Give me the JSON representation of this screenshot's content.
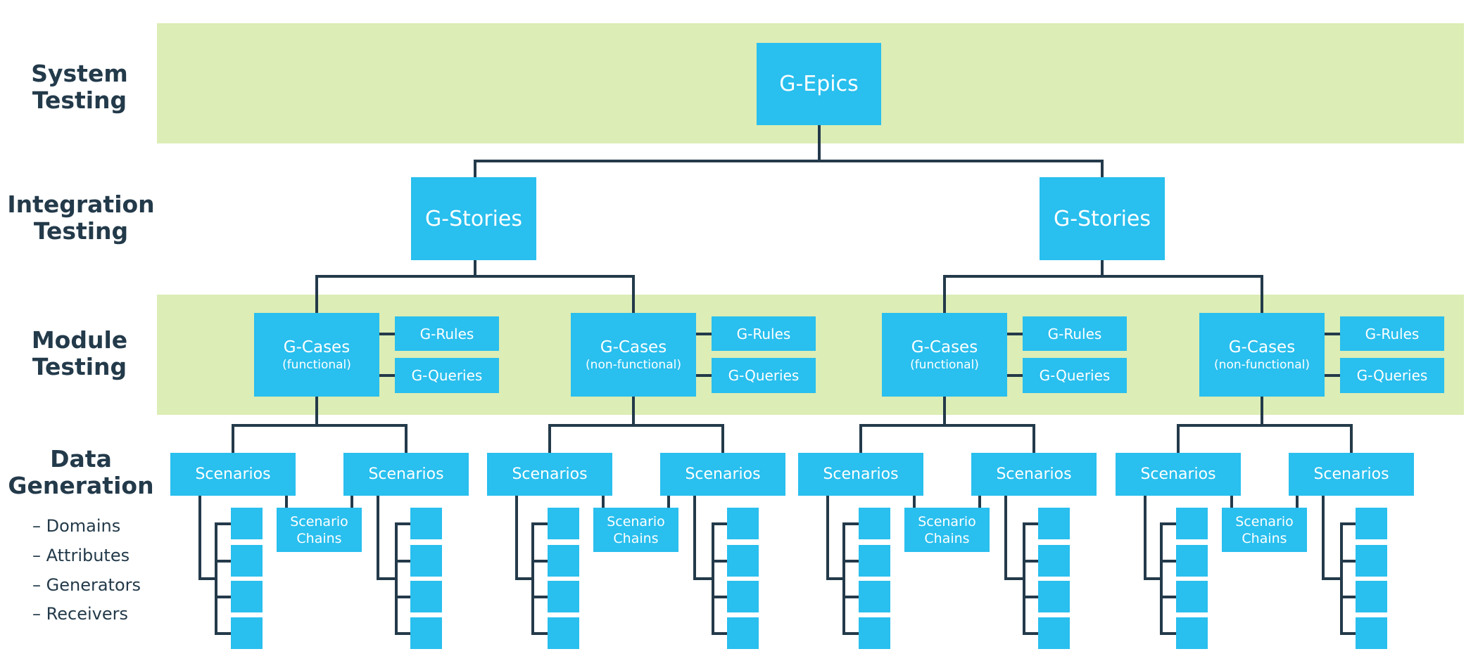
{
  "levels": {
    "system": [
      "System",
      "Testing"
    ],
    "integration": [
      "Integration",
      "Testing"
    ],
    "module": [
      "Module",
      "Testing"
    ],
    "data": [
      "Data",
      "Generation"
    ]
  },
  "data_items": [
    "– Domains",
    "– Attributes",
    "– Generators",
    "– Receivers"
  ],
  "epic": "G-Epics",
  "stories": [
    "G-Stories",
    "G-Stories"
  ],
  "case_groups": [
    {
      "title": "G-Cases",
      "subtitle": "(functional)",
      "rules": "G-Rules",
      "queries": "G-Queries",
      "scenarios": [
        "Scenarios",
        "Scenarios"
      ],
      "chains": [
        "Scenario",
        "Chains"
      ]
    },
    {
      "title": "G-Cases",
      "subtitle": "(non-functional)",
      "rules": "G-Rules",
      "queries": "G-Queries",
      "scenarios": [
        "Scenarios",
        "Scenarios"
      ],
      "chains": [
        "Scenario",
        "Chains"
      ]
    },
    {
      "title": "G-Cases",
      "subtitle": "(functional)",
      "rules": "G-Rules",
      "queries": "G-Queries",
      "scenarios": [
        "Scenarios",
        "Scenarios"
      ],
      "chains": [
        "Scenario",
        "Chains"
      ]
    },
    {
      "title": "G-Cases",
      "subtitle": "(non-functional)",
      "rules": "G-Rules",
      "queries": "G-Queries",
      "scenarios": [
        "Scenarios",
        "Scenarios"
      ],
      "chains": [
        "Scenario",
        "Chains"
      ]
    }
  ],
  "colors": {
    "band": "#dcedb5",
    "node": "#29bfee",
    "line": "#233a4a",
    "label": "#233a4a"
  }
}
